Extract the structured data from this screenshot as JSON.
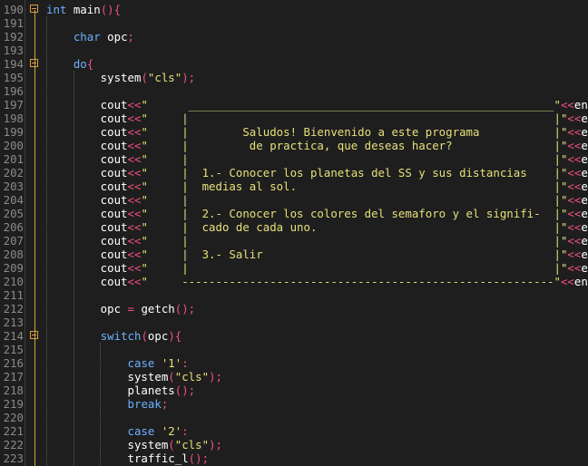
{
  "editor": {
    "lines": [
      {
        "num": "190",
        "fold": true,
        "segments": [
          {
            "t": "int",
            "c": "kw"
          },
          {
            "t": " main",
            "c": "plain"
          },
          {
            "t": "(){",
            "c": "op"
          }
        ]
      },
      {
        "num": "191",
        "segments": []
      },
      {
        "num": "192",
        "segments": [
          {
            "t": "    ",
            "c": "plain"
          },
          {
            "t": "char",
            "c": "kw"
          },
          {
            "t": " opc",
            "c": "plain"
          },
          {
            "t": ";",
            "c": "op"
          }
        ]
      },
      {
        "num": "193",
        "segments": []
      },
      {
        "num": "194",
        "fold": true,
        "segments": [
          {
            "t": "    ",
            "c": "plain"
          },
          {
            "t": "do",
            "c": "kw"
          },
          {
            "t": "{",
            "c": "op"
          }
        ]
      },
      {
        "num": "195",
        "segments": [
          {
            "t": "        system",
            "c": "plain"
          },
          {
            "t": "(",
            "c": "op"
          },
          {
            "t": "\"cls\"",
            "c": "str"
          },
          {
            "t": ");",
            "c": "op"
          }
        ]
      },
      {
        "num": "196",
        "segments": []
      },
      {
        "num": "197",
        "segments": [
          {
            "t": "        cout",
            "c": "plain"
          },
          {
            "t": "<<",
            "c": "op"
          },
          {
            "t": "\"      ______________________________________________________\"",
            "c": "str"
          },
          {
            "t": "<<",
            "c": "op"
          },
          {
            "t": "endl",
            "c": "plain"
          },
          {
            "t": ";",
            "c": "op"
          }
        ]
      },
      {
        "num": "198",
        "segments": [
          {
            "t": "        cout",
            "c": "plain"
          },
          {
            "t": "<<",
            "c": "op"
          },
          {
            "t": "\"     |                                                      |\"",
            "c": "str"
          },
          {
            "t": "<<",
            "c": "op"
          },
          {
            "t": "endl",
            "c": "plain"
          },
          {
            "t": ";",
            "c": "op"
          }
        ]
      },
      {
        "num": "199",
        "segments": [
          {
            "t": "        cout",
            "c": "plain"
          },
          {
            "t": "<<",
            "c": "op"
          },
          {
            "t": "\"     |        Saludos! Bienvenido a este programa           |\"",
            "c": "str"
          },
          {
            "t": "<<",
            "c": "op"
          },
          {
            "t": "endl",
            "c": "plain"
          },
          {
            "t": ";",
            "c": "op"
          }
        ]
      },
      {
        "num": "200",
        "segments": [
          {
            "t": "        cout",
            "c": "plain"
          },
          {
            "t": "<<",
            "c": "op"
          },
          {
            "t": "\"     |         de practica, que deseas hacer?               |\"",
            "c": "str"
          },
          {
            "t": "<<",
            "c": "op"
          },
          {
            "t": "endl",
            "c": "plain"
          },
          {
            "t": ";",
            "c": "op"
          }
        ]
      },
      {
        "num": "201",
        "segments": [
          {
            "t": "        cout",
            "c": "plain"
          },
          {
            "t": "<<",
            "c": "op"
          },
          {
            "t": "\"     |                                                      |\"",
            "c": "str"
          },
          {
            "t": "<<",
            "c": "op"
          },
          {
            "t": "endl",
            "c": "plain"
          },
          {
            "t": ";",
            "c": "op"
          }
        ]
      },
      {
        "num": "202",
        "segments": [
          {
            "t": "        cout",
            "c": "plain"
          },
          {
            "t": "<<",
            "c": "op"
          },
          {
            "t": "\"     |  1.- Conocer los planetas del SS y sus distancias    |\"",
            "c": "str"
          },
          {
            "t": "<<",
            "c": "op"
          },
          {
            "t": "endl",
            "c": "plain"
          },
          {
            "t": ";",
            "c": "op"
          }
        ]
      },
      {
        "num": "203",
        "segments": [
          {
            "t": "        cout",
            "c": "plain"
          },
          {
            "t": "<<",
            "c": "op"
          },
          {
            "t": "\"     |  medias al sol.                                      |\"",
            "c": "str"
          },
          {
            "t": "<<",
            "c": "op"
          },
          {
            "t": "endl",
            "c": "plain"
          },
          {
            "t": ";",
            "c": "op"
          }
        ]
      },
      {
        "num": "204",
        "segments": [
          {
            "t": "        cout",
            "c": "plain"
          },
          {
            "t": "<<",
            "c": "op"
          },
          {
            "t": "\"     |                                                      |\"",
            "c": "str"
          },
          {
            "t": "<<",
            "c": "op"
          },
          {
            "t": "endl",
            "c": "plain"
          },
          {
            "t": ";",
            "c": "op"
          }
        ]
      },
      {
        "num": "205",
        "segments": [
          {
            "t": "        cout",
            "c": "plain"
          },
          {
            "t": "<<",
            "c": "op"
          },
          {
            "t": "\"     |  2.- Conocer los colores del semaforo y el signifi-  |\"",
            "c": "str"
          },
          {
            "t": "<<",
            "c": "op"
          },
          {
            "t": "endl",
            "c": "plain"
          },
          {
            "t": ";",
            "c": "op"
          }
        ]
      },
      {
        "num": "206",
        "segments": [
          {
            "t": "        cout",
            "c": "plain"
          },
          {
            "t": "<<",
            "c": "op"
          },
          {
            "t": "\"     |  cado de cada uno.                                   |\"",
            "c": "str"
          },
          {
            "t": "<<",
            "c": "op"
          },
          {
            "t": "endl",
            "c": "plain"
          },
          {
            "t": ";",
            "c": "op"
          }
        ]
      },
      {
        "num": "207",
        "segments": [
          {
            "t": "        cout",
            "c": "plain"
          },
          {
            "t": "<<",
            "c": "op"
          },
          {
            "t": "\"     |                                                      |\"",
            "c": "str"
          },
          {
            "t": "<<",
            "c": "op"
          },
          {
            "t": "endl",
            "c": "plain"
          },
          {
            "t": ";",
            "c": "op"
          }
        ]
      },
      {
        "num": "208",
        "segments": [
          {
            "t": "        cout",
            "c": "plain"
          },
          {
            "t": "<<",
            "c": "op"
          },
          {
            "t": "\"     |  3.- Salir                                           |\"",
            "c": "str"
          },
          {
            "t": "<<",
            "c": "op"
          },
          {
            "t": "endl",
            "c": "plain"
          },
          {
            "t": ";",
            "c": "op"
          }
        ]
      },
      {
        "num": "209",
        "segments": [
          {
            "t": "        cout",
            "c": "plain"
          },
          {
            "t": "<<",
            "c": "op"
          },
          {
            "t": "\"     |                                                      |\"",
            "c": "str"
          },
          {
            "t": "<<",
            "c": "op"
          },
          {
            "t": "endl",
            "c": "plain"
          },
          {
            "t": ";",
            "c": "op"
          }
        ]
      },
      {
        "num": "210",
        "segments": [
          {
            "t": "        cout",
            "c": "plain"
          },
          {
            "t": "<<",
            "c": "op"
          },
          {
            "t": "\"     -------------------------------------------------------\"",
            "c": "str"
          },
          {
            "t": "<<",
            "c": "op"
          },
          {
            "t": "endl",
            "c": "plain"
          },
          {
            "t": ";",
            "c": "op"
          }
        ]
      },
      {
        "num": "211",
        "segments": []
      },
      {
        "num": "212",
        "segments": [
          {
            "t": "        opc ",
            "c": "plain"
          },
          {
            "t": "=",
            "c": "op"
          },
          {
            "t": " getch",
            "c": "plain"
          },
          {
            "t": "();",
            "c": "op"
          }
        ]
      },
      {
        "num": "213",
        "segments": []
      },
      {
        "num": "214",
        "fold": true,
        "segments": [
          {
            "t": "        ",
            "c": "plain"
          },
          {
            "t": "switch",
            "c": "kw"
          },
          {
            "t": "(",
            "c": "op"
          },
          {
            "t": "opc",
            "c": "plain"
          },
          {
            "t": "){",
            "c": "op"
          }
        ]
      },
      {
        "num": "215",
        "segments": []
      },
      {
        "num": "216",
        "segments": [
          {
            "t": "            ",
            "c": "plain"
          },
          {
            "t": "case",
            "c": "kw"
          },
          {
            "t": " ",
            "c": "plain"
          },
          {
            "t": "'1'",
            "c": "str"
          },
          {
            "t": ":",
            "c": "op"
          }
        ]
      },
      {
        "num": "217",
        "segments": [
          {
            "t": "            system",
            "c": "plain"
          },
          {
            "t": "(",
            "c": "op"
          },
          {
            "t": "\"cls\"",
            "c": "str"
          },
          {
            "t": ");",
            "c": "op"
          }
        ]
      },
      {
        "num": "218",
        "segments": [
          {
            "t": "            planets",
            "c": "plain"
          },
          {
            "t": "();",
            "c": "op"
          }
        ]
      },
      {
        "num": "219",
        "segments": [
          {
            "t": "            ",
            "c": "plain"
          },
          {
            "t": "break",
            "c": "kw"
          },
          {
            "t": ";",
            "c": "op"
          }
        ]
      },
      {
        "num": "220",
        "segments": []
      },
      {
        "num": "221",
        "segments": [
          {
            "t": "            ",
            "c": "plain"
          },
          {
            "t": "case",
            "c": "kw"
          },
          {
            "t": " ",
            "c": "plain"
          },
          {
            "t": "'2'",
            "c": "str"
          },
          {
            "t": ":",
            "c": "op"
          }
        ]
      },
      {
        "num": "222",
        "segments": [
          {
            "t": "            system",
            "c": "plain"
          },
          {
            "t": "(",
            "c": "op"
          },
          {
            "t": "\"cls\"",
            "c": "str"
          },
          {
            "t": ");",
            "c": "op"
          }
        ]
      },
      {
        "num": "223",
        "segments": [
          {
            "t": "            traffic_l",
            "c": "plain"
          },
          {
            "t": "();",
            "c": "op"
          }
        ]
      }
    ]
  },
  "colors": {
    "background": "#1e1e1e",
    "keyword": "#6db0ff",
    "string": "#e5e07a",
    "operator": "#f05080",
    "line_number": "#8a8a8a",
    "fold_marker": "#d8a040"
  }
}
